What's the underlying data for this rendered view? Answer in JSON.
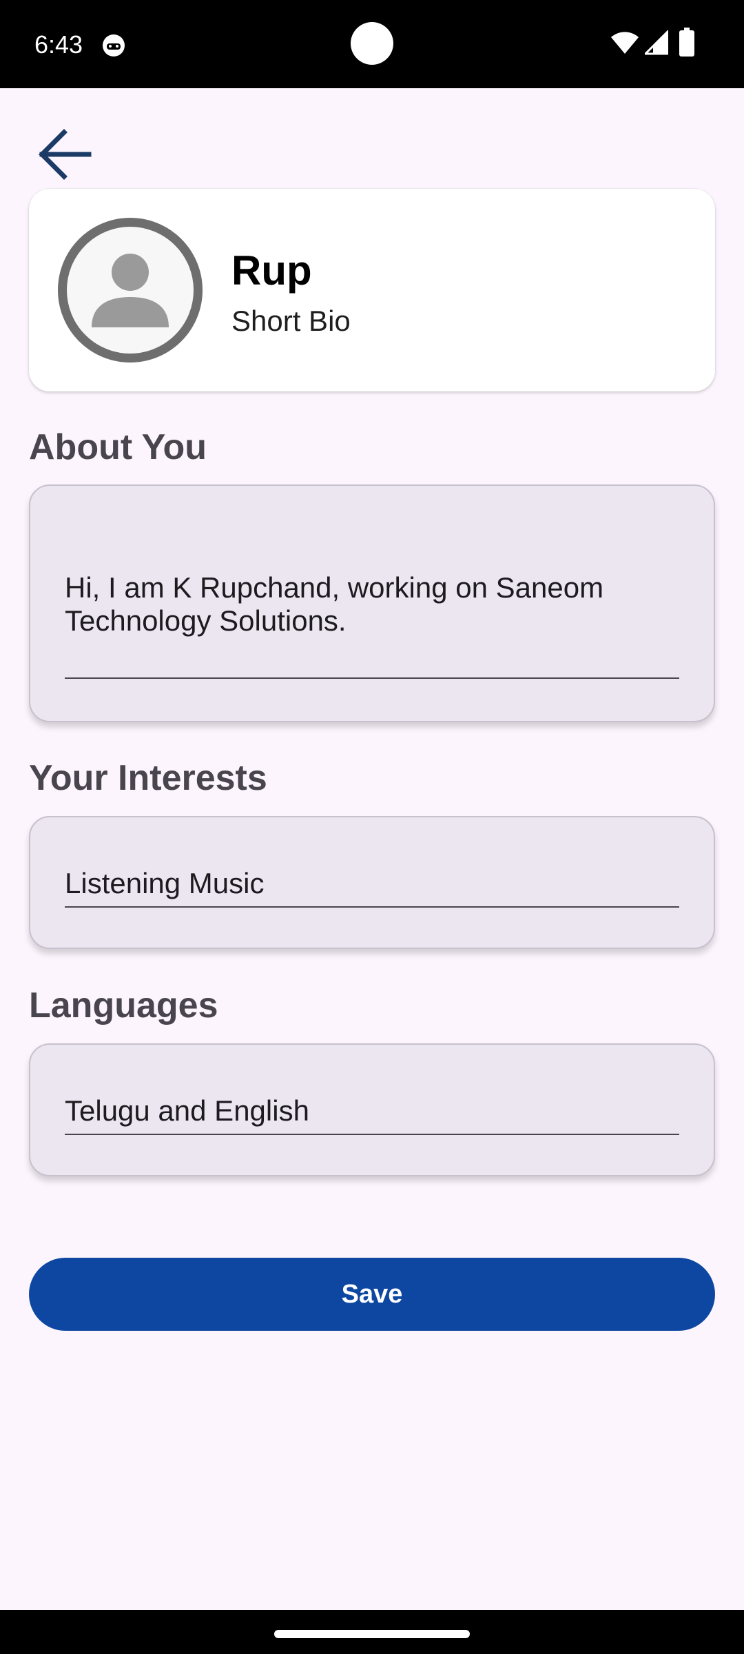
{
  "status_bar": {
    "time": "6:43",
    "icons": [
      "cat-notification-icon",
      "wifi-icon",
      "cellular-signal-icon",
      "battery-icon"
    ]
  },
  "header": {
    "back_icon": "arrow-back-icon"
  },
  "profile": {
    "name": "Rup",
    "bio": "Short Bio",
    "avatar_icon": "person-icon"
  },
  "about": {
    "label": "About You",
    "value": "Hi, I am K Rupchand, working on Saneom Technology Solutions."
  },
  "interests": {
    "label": "Your Interests",
    "value": "Listening Music"
  },
  "languages": {
    "label": "Languages",
    "value": "Telugu and English"
  },
  "actions": {
    "save_label": "Save"
  },
  "colors": {
    "background": "#FCF5FD",
    "accent": "#0E47A1",
    "field_background": "#ECE6F1",
    "section_label": "#49454F",
    "back_icon": "#1B3A66"
  }
}
